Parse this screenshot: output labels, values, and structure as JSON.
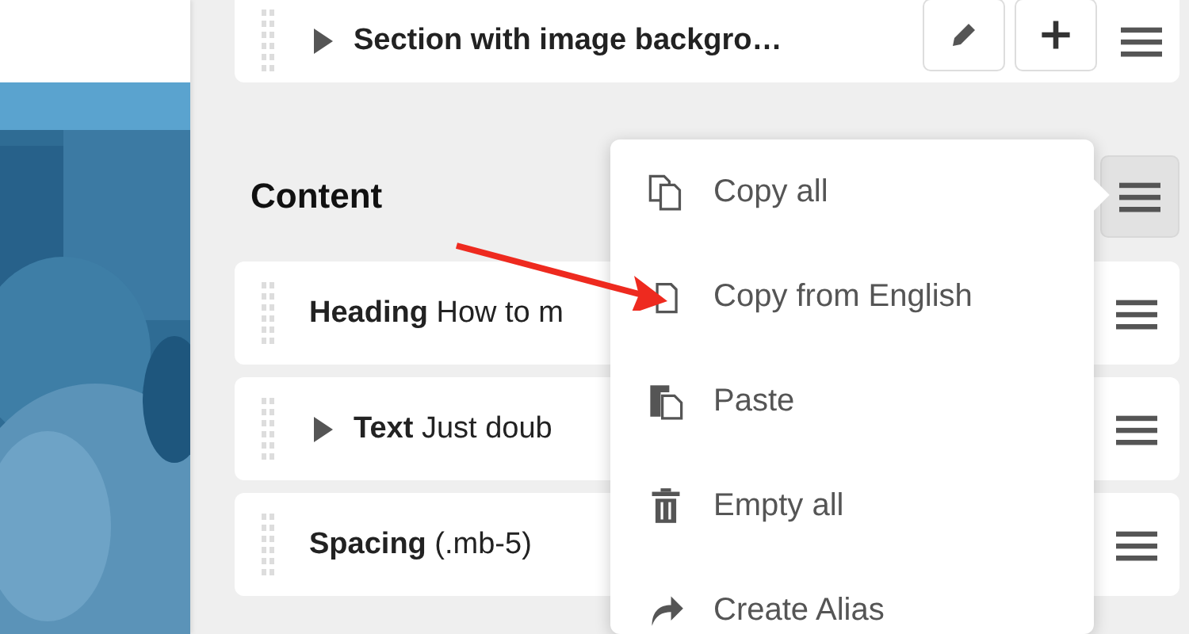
{
  "section": {
    "kind": "group",
    "name": "Section with image backgro…"
  },
  "content": {
    "title": "Content",
    "menu_active": true,
    "rows": [
      {
        "kind": "item",
        "name": "Heading",
        "summary": "How to m",
        "menu_active": false
      },
      {
        "kind": "group",
        "name": "Text",
        "summary": "Just doub",
        "menu_active": false
      },
      {
        "kind": "item",
        "name": "Spacing",
        "summary": "(.mb-5)",
        "menu_active": false
      }
    ]
  },
  "menu": {
    "items": [
      {
        "label": "Copy all"
      },
      {
        "label": "Copy from English"
      },
      {
        "label": "Paste"
      },
      {
        "label": "Empty all"
      },
      {
        "label": "Create Alias"
      }
    ]
  }
}
